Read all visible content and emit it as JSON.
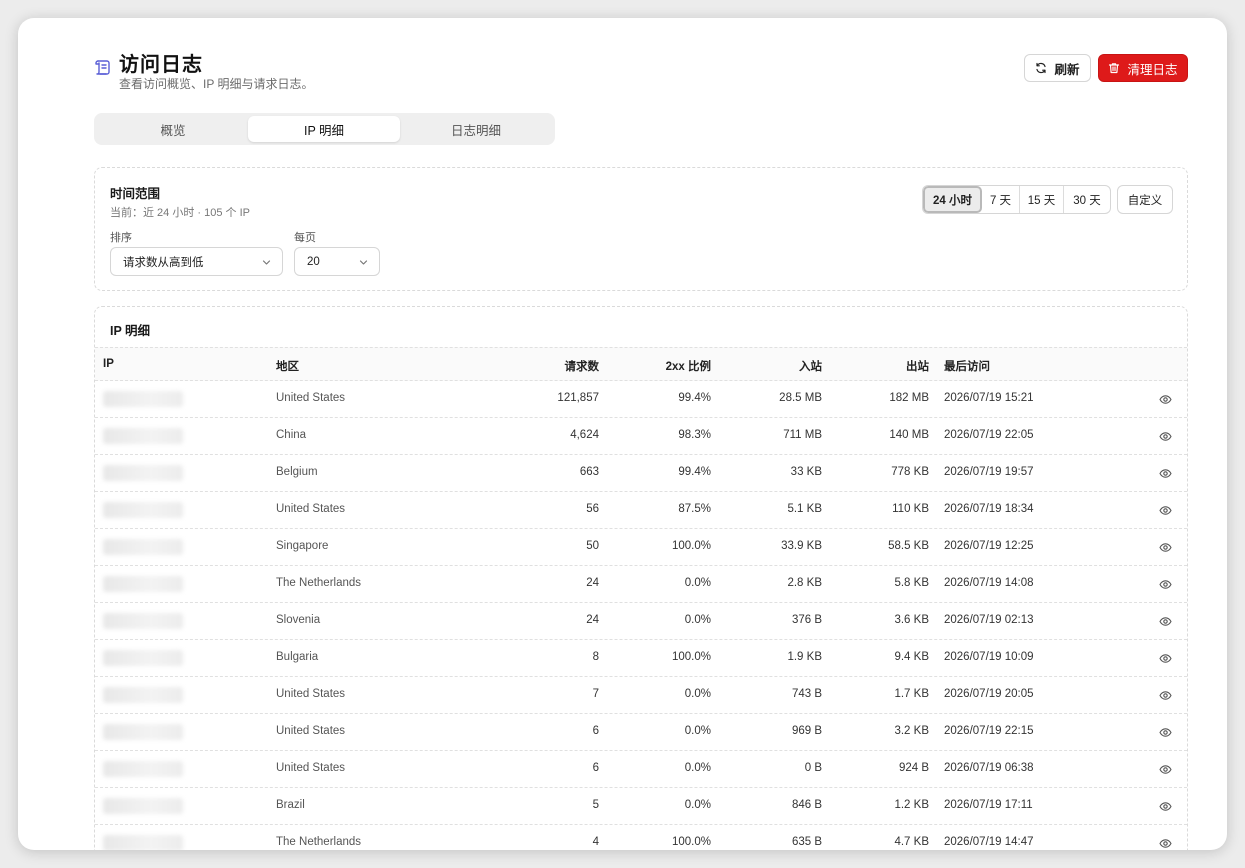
{
  "header": {
    "title": "访问日志",
    "subtitle": "查看访问概览、IP 明细与请求日志。",
    "refresh_label": "刷新",
    "clear_label": "清理日志"
  },
  "tabs": [
    {
      "label": "概览",
      "active": false
    },
    {
      "label": "IP 明细",
      "active": true
    },
    {
      "label": "日志明细",
      "active": false
    }
  ],
  "filters": {
    "title": "时间范围",
    "current": "当前：近 24 小时 · 105 个 IP",
    "sort_label": "排序",
    "sort_value": "请求数从高到低",
    "per_page_label": "每页",
    "per_page_value": "20",
    "ranges": [
      {
        "label": "24 小时",
        "active": true
      },
      {
        "label": "7 天",
        "active": false
      },
      {
        "label": "15 天",
        "active": false
      },
      {
        "label": "30 天",
        "active": false
      }
    ],
    "custom_label": "自定义"
  },
  "table": {
    "title": "IP 明细",
    "columns": [
      "IP",
      "地区",
      "请求数",
      "2xx 比例",
      "入站",
      "出站",
      "最后访问"
    ],
    "rows": [
      {
        "region": "United States",
        "requests": "121,857",
        "ratio": "99.4%",
        "inbound": "28.5 MB",
        "outbound": "182 MB",
        "last": "2026/07/19 15:21"
      },
      {
        "region": "China",
        "requests": "4,624",
        "ratio": "98.3%",
        "inbound": "711 MB",
        "outbound": "140 MB",
        "last": "2026/07/19 22:05"
      },
      {
        "region": "Belgium",
        "requests": "663",
        "ratio": "99.4%",
        "inbound": "33 KB",
        "outbound": "778 KB",
        "last": "2026/07/19 19:57"
      },
      {
        "region": "United States",
        "requests": "56",
        "ratio": "87.5%",
        "inbound": "5.1 KB",
        "outbound": "110 KB",
        "last": "2026/07/19 18:34"
      },
      {
        "region": "Singapore",
        "requests": "50",
        "ratio": "100.0%",
        "inbound": "33.9 KB",
        "outbound": "58.5 KB",
        "last": "2026/07/19 12:25"
      },
      {
        "region": "The Netherlands",
        "requests": "24",
        "ratio": "0.0%",
        "inbound": "2.8 KB",
        "outbound": "5.8 KB",
        "last": "2026/07/19 14:08"
      },
      {
        "region": "Slovenia",
        "requests": "24",
        "ratio": "0.0%",
        "inbound": "376 B",
        "outbound": "3.6 KB",
        "last": "2026/07/19 02:13"
      },
      {
        "region": "Bulgaria",
        "requests": "8",
        "ratio": "100.0%",
        "inbound": "1.9 KB",
        "outbound": "9.4 KB",
        "last": "2026/07/19 10:09"
      },
      {
        "region": "United States",
        "requests": "7",
        "ratio": "0.0%",
        "inbound": "743 B",
        "outbound": "1.7 KB",
        "last": "2026/07/19 20:05"
      },
      {
        "region": "United States",
        "requests": "6",
        "ratio": "0.0%",
        "inbound": "969 B",
        "outbound": "3.2 KB",
        "last": "2026/07/19 22:15"
      },
      {
        "region": "United States",
        "requests": "6",
        "ratio": "0.0%",
        "inbound": "0 B",
        "outbound": "924 B",
        "last": "2026/07/19 06:38"
      },
      {
        "region": "Brazil",
        "requests": "5",
        "ratio": "0.0%",
        "inbound": "846 B",
        "outbound": "1.2 KB",
        "last": "2026/07/19 17:11"
      },
      {
        "region": "The Netherlands",
        "requests": "4",
        "ratio": "100.0%",
        "inbound": "635 B",
        "outbound": "4.7 KB",
        "last": "2026/07/19 14:47"
      }
    ]
  },
  "icons": {
    "title": "scroll-icon",
    "refresh": "refresh-icon",
    "clear": "trash-icon",
    "select": "chevron-down-icon",
    "row_action": "eye-icon"
  },
  "colors": {
    "accent_icon": "#5a5fd6",
    "danger": "#de1a1a"
  }
}
